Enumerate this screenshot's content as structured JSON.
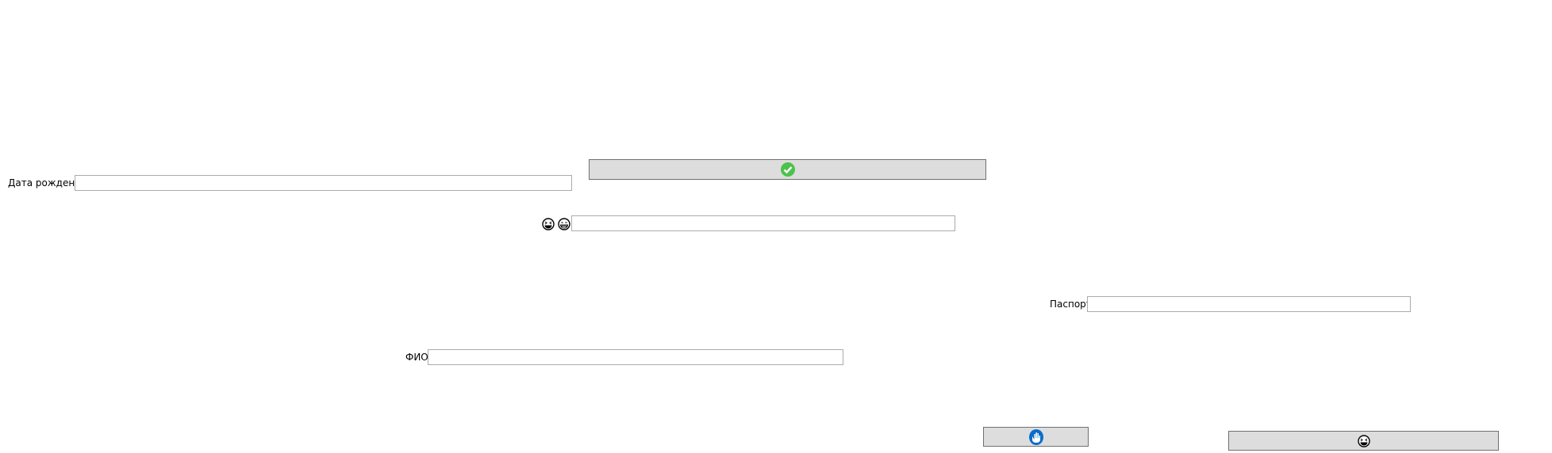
{
  "form": {
    "confirm_button": {
      "icon": "check-circle-icon",
      "color": "#4cc24c"
    },
    "birth_date": {
      "label": "Дата рождения",
      "value": ""
    },
    "emoji_field": {
      "icons": [
        "grinning-squint-face-icon",
        "grinning-face-icon"
      ],
      "value": ""
    },
    "passport": {
      "label": "Паспорт",
      "value": ""
    },
    "full_name": {
      "label": "ФИО",
      "value": ""
    },
    "hand_button": {
      "icon": "hand-icon",
      "color": "#0a6cc8"
    },
    "emoji_button": {
      "icon": "grinning-squint-face-icon"
    }
  }
}
